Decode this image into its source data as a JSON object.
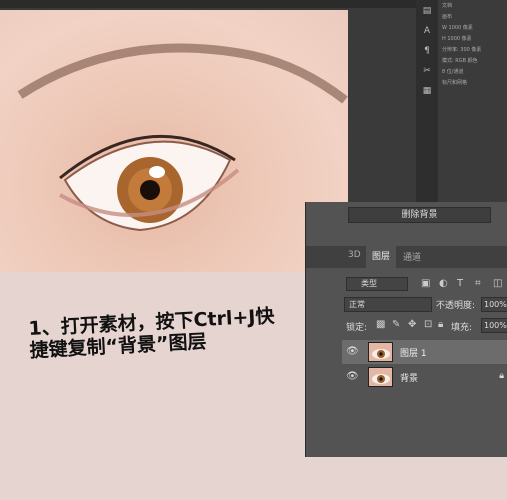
{
  "properties_panel": {
    "lines": [
      "文档",
      "画布",
      "W 1000 像素",
      "H 1000 像素",
      "分辨率: 300 像素",
      "模式: RGB 颜色",
      "8 位/通道",
      "标尺和网格"
    ]
  },
  "layers_panel": {
    "delete_bg_label": "删除背景",
    "tabs": [
      "3D",
      "图层",
      "通道"
    ],
    "filter_label": "类型",
    "blend_mode": "正常",
    "opacity_label": "不透明度:",
    "opacity_value": "100%",
    "lock_label": "锁定:",
    "fill_label": "填充:",
    "fill_value": "100%",
    "layers": [
      {
        "name": "图层 1",
        "selected": true
      },
      {
        "name": "背景",
        "locked": true
      }
    ]
  },
  "instruction": {
    "line1": "1、打开素材，按下Ctrl+J快",
    "line2": "捷键复制“背景”图层"
  },
  "colors": {
    "panel_bg": "#535353",
    "panel_dark": "#3b3b3b",
    "selected_layer": "#6c6c6c",
    "page_bg": "#e5d4cf"
  }
}
